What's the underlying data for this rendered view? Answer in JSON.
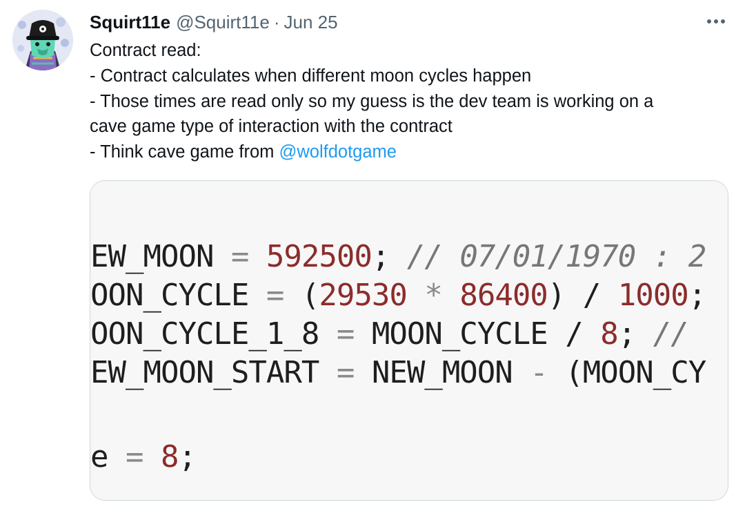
{
  "tweet": {
    "display_name": "Squirt11e",
    "handle": "@Squirt11e",
    "separator": "·",
    "date": "Jun 25",
    "more_icon": "ellipsis-icon",
    "lines": [
      "Contract read:",
      "- Contract calculates when different moon cycles happen",
      "- Those times are read only so my guess is the dev team is working on a",
      "cave game type of interaction with the contract"
    ],
    "last_line_prefix": "- Think cave game from ",
    "mention": "@wolfdotgame",
    "colors": {
      "mention": "#1d9bf0",
      "secondary_text": "#536471",
      "code_number": "#8c2c2c"
    }
  },
  "code_image": {
    "lines": [
      [
        {
          "t": "EW_MOON",
          "c": "id"
        },
        {
          "t": " = ",
          "c": "op"
        },
        {
          "t": "592500",
          "c": "num"
        },
        {
          "t": "; ",
          "c": "id"
        },
        {
          "t": "// 07/01/1970 : 2",
          "c": "cmt"
        }
      ],
      [
        {
          "t": "OON_CYCLE",
          "c": "id"
        },
        {
          "t": " = ",
          "c": "op"
        },
        {
          "t": "(",
          "c": "id"
        },
        {
          "t": "29530",
          "c": "num"
        },
        {
          "t": " * ",
          "c": "op"
        },
        {
          "t": "86400",
          "c": "num"
        },
        {
          "t": ") / ",
          "c": "id"
        },
        {
          "t": "1000",
          "c": "num"
        },
        {
          "t": ";",
          "c": "id"
        }
      ],
      [
        {
          "t": "OON_CYCLE_1_8",
          "c": "id"
        },
        {
          "t": " = ",
          "c": "op"
        },
        {
          "t": "MOON_CYCLE / ",
          "c": "id"
        },
        {
          "t": "8",
          "c": "num"
        },
        {
          "t": "; ",
          "c": "id"
        },
        {
          "t": "//",
          "c": "cmt"
        }
      ],
      [
        {
          "t": "EW_MOON_START",
          "c": "id"
        },
        {
          "t": " = ",
          "c": "op"
        },
        {
          "t": "NEW_MOON ",
          "c": "id"
        },
        {
          "t": "-",
          "c": "op"
        },
        {
          "t": " (MOON_CY",
          "c": "id"
        }
      ],
      [],
      [
        {
          "t": "e",
          "c": "id"
        },
        {
          "t": " = ",
          "c": "op"
        },
        {
          "t": "8",
          "c": "num"
        },
        {
          "t": ";",
          "c": "id"
        }
      ]
    ]
  }
}
